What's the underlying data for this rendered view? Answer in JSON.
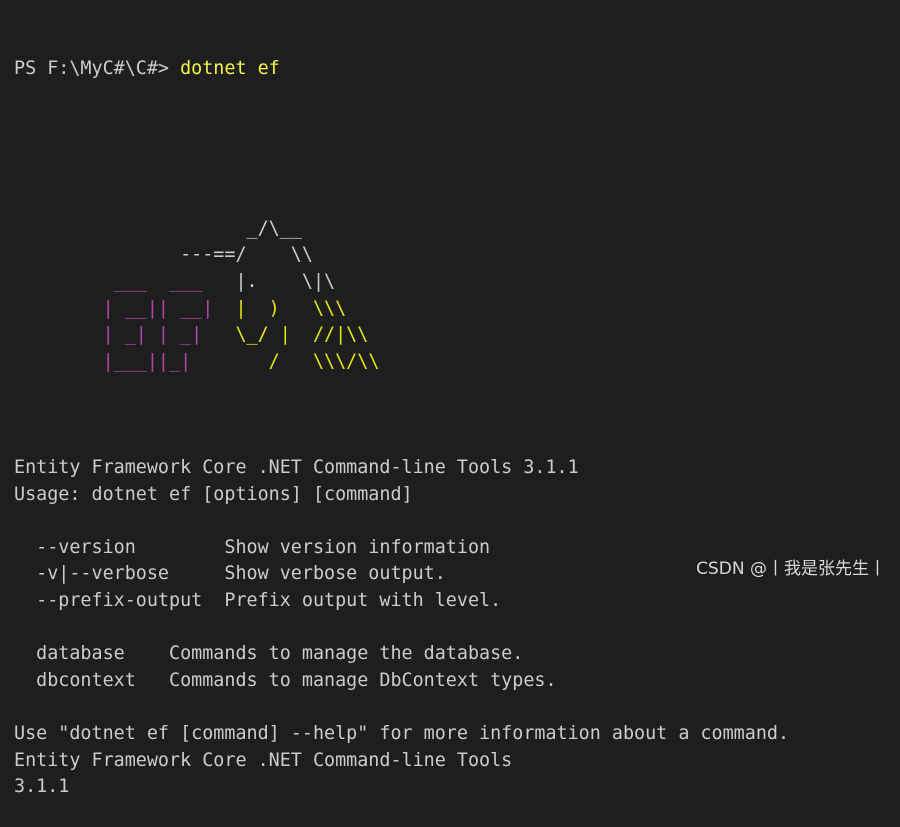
{
  "terminal": {
    "prompt": "PS F:\\MyC#\\C#> ",
    "command": "dotnet ef",
    "ascii_art": [
      [
        {
          "c": "wht",
          "t": "                     _/\\__"
        }
      ],
      [
        {
          "c": "wht",
          "t": "               ---==/    \\\\"
        }
      ],
      [
        {
          "c": "mag",
          "t": "         ___  ___   "
        },
        {
          "c": "wht",
          "t": "|.    \\|\\"
        }
      ],
      [
        {
          "c": "mag",
          "t": "        | __|| __|  "
        },
        {
          "c": "ylw",
          "t": "|  )   \\\\\\"
        }
      ],
      [
        {
          "c": "mag",
          "t": "        | _| | _|   "
        },
        {
          "c": "ylw",
          "t": "\\_/ |  //|\\\\"
        }
      ],
      [
        {
          "c": "mag",
          "t": "        |___||_|       "
        },
        {
          "c": "ylw",
          "t": "/   \\\\\\/\\\\"
        }
      ]
    ],
    "lines": [
      "",
      "Entity Framework Core .NET Command-line Tools 3.1.1",
      "Usage: dotnet ef [options] [command]",
      "",
      "  --version        Show version information",
      "  -v|--verbose     Show verbose output.",
      "  --prefix-output  Prefix output with level.",
      "",
      "  database    Commands to manage the database.",
      "  dbcontext   Commands to manage DbContext types.",
      "",
      "Use \"dotnet ef [command] --help\" for more information about a command.",
      "Entity Framework Core .NET Command-line Tools",
      "3.1.1"
    ]
  },
  "watermark": "CSDN @丨我是张先生丨"
}
